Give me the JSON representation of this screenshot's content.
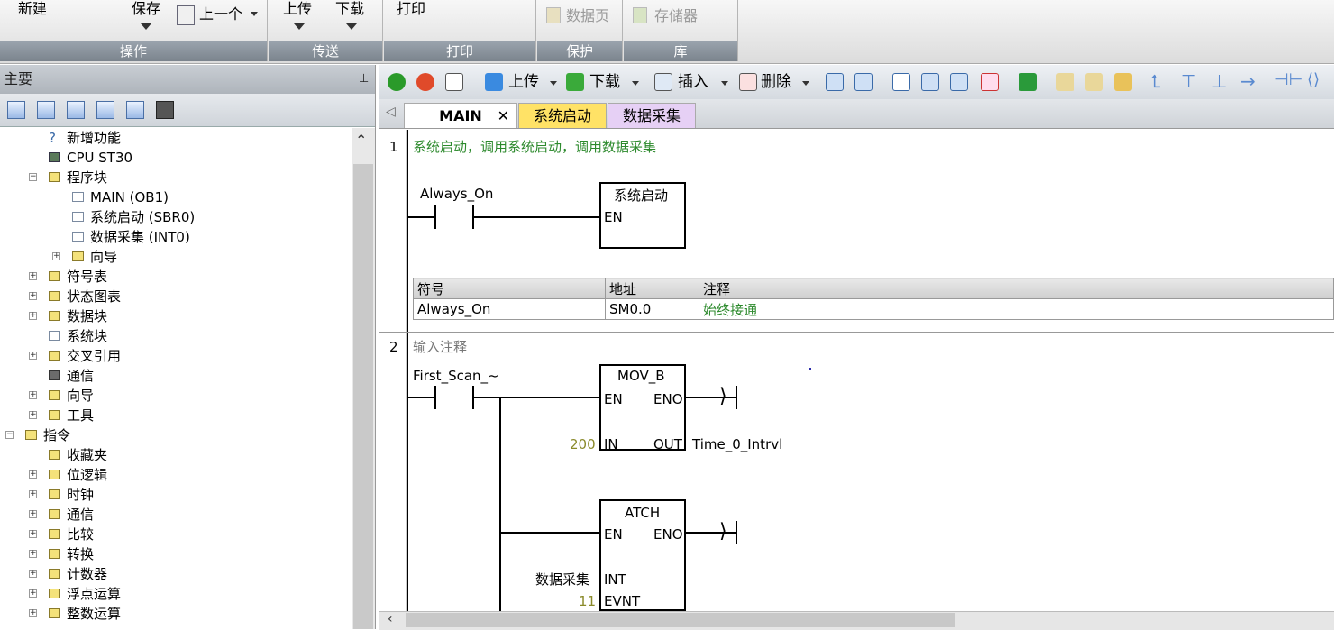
{
  "ribbon": {
    "groups": [
      {
        "label": "操作",
        "buttons": [
          "新建",
          "保存",
          "上一个"
        ]
      },
      {
        "label": "传送",
        "buttons": [
          "上传",
          "下载"
        ]
      },
      {
        "label": "打印",
        "buttons": [
          "打印"
        ]
      },
      {
        "label": "保护",
        "buttons": [
          "数据页"
        ]
      },
      {
        "label": "库",
        "buttons": [
          "存储器"
        ]
      }
    ]
  },
  "left_panel": {
    "title": "主要",
    "tree": [
      {
        "label": "新增功能"
      },
      {
        "label": "CPU ST30"
      },
      {
        "label": "程序块"
      },
      {
        "label": "MAIN (OB1)"
      },
      {
        "label": "系统启动 (SBR0)"
      },
      {
        "label": "数据采集 (INT0)"
      },
      {
        "label": "向导"
      },
      {
        "label": "符号表"
      },
      {
        "label": "状态图表"
      },
      {
        "label": "数据块"
      },
      {
        "label": "系统块"
      },
      {
        "label": "交叉引用"
      },
      {
        "label": "通信"
      },
      {
        "label": "向导"
      },
      {
        "label": "工具"
      },
      {
        "label": "指令"
      },
      {
        "label": "收藏夹"
      },
      {
        "label": "位逻辑"
      },
      {
        "label": "时钟"
      },
      {
        "label": "通信"
      },
      {
        "label": "比较"
      },
      {
        "label": "转换"
      },
      {
        "label": "计数器"
      },
      {
        "label": "浮点运算"
      },
      {
        "label": "整数运算"
      }
    ]
  },
  "editor": {
    "toolbar": {
      "upload": "上传",
      "download": "下载",
      "insert": "插入",
      "delete": "删除"
    },
    "tabs": [
      "MAIN",
      "系统启动",
      "数据采集"
    ],
    "networks": [
      {
        "number": "1",
        "comment": "系统启动，调用系统启动，调用数据采集",
        "contact": "Always_On",
        "box_title": "系统启动",
        "box_en": "EN",
        "symbol_table": {
          "headers": [
            "符号",
            "地址",
            "注释"
          ],
          "rows": [
            [
              "Always_On",
              "SM0.0",
              "始终接通"
            ]
          ]
        }
      },
      {
        "number": "2",
        "comment": "输入注释",
        "contact": "First_Scan_~",
        "mov": {
          "title": "MOV_B",
          "en": "EN",
          "eno": "ENO",
          "in": "IN",
          "out": "OUT",
          "in_value": "200",
          "out_value": "Time_0_Intrvl"
        },
        "atch": {
          "title": "ATCH",
          "en": "EN",
          "eno": "ENO",
          "int": "INT",
          "evnt": "EVNT",
          "int_value": "数据采集",
          "evnt_value": "11"
        }
      }
    ]
  }
}
